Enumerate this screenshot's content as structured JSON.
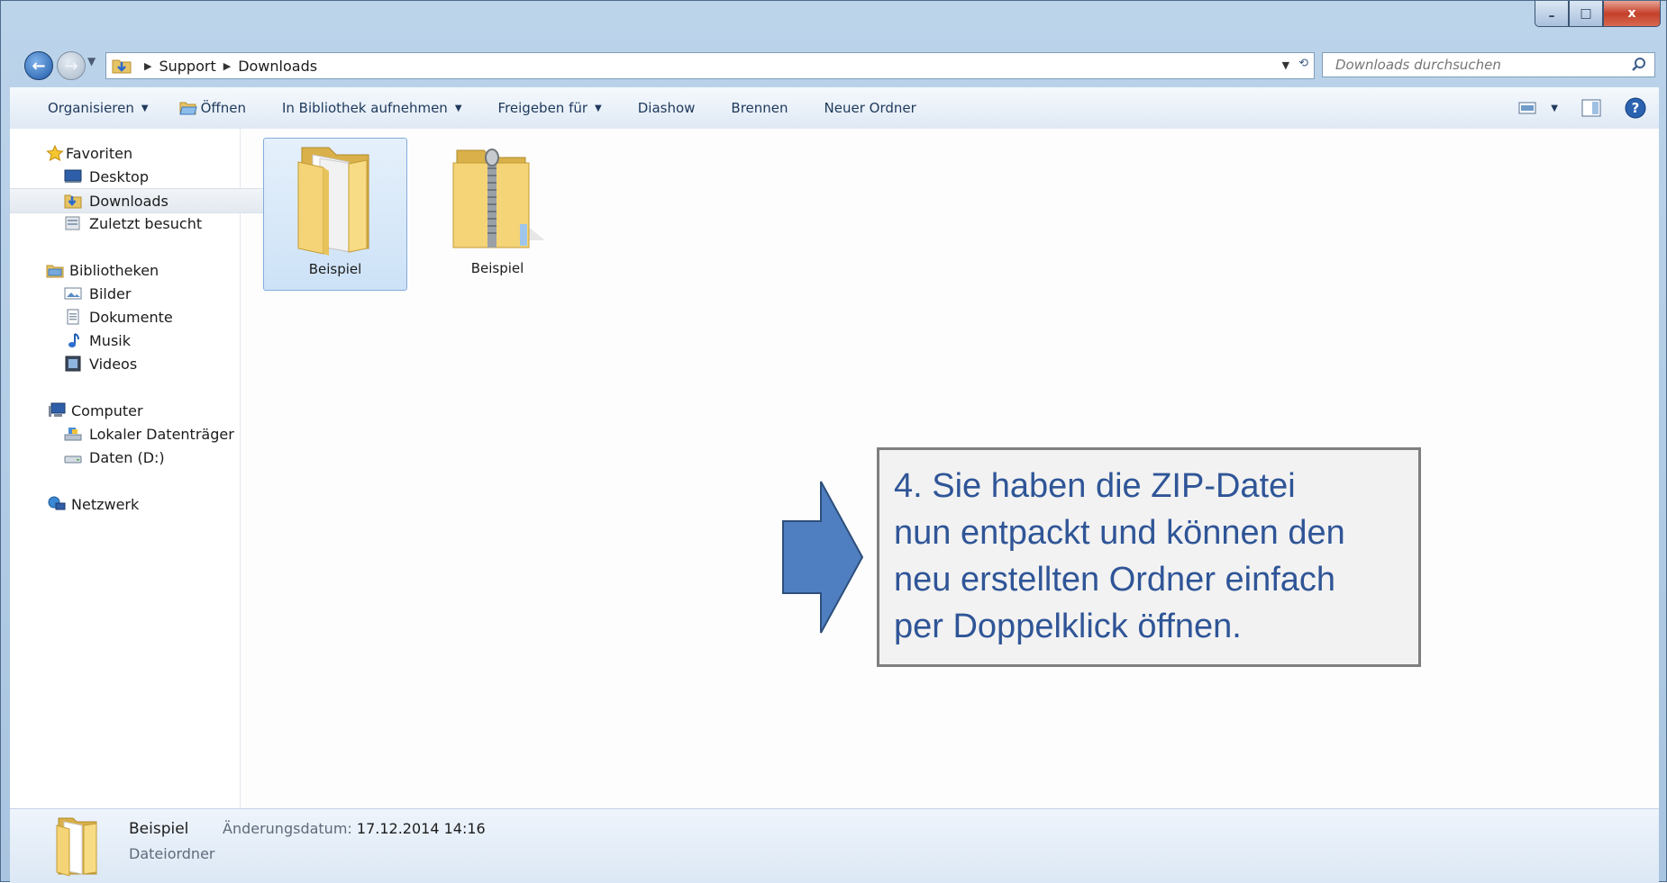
{
  "window": {
    "minimize": "–",
    "maximize": "□",
    "close": "x"
  },
  "address": {
    "crumbs": [
      "Support",
      "Downloads"
    ],
    "search_placeholder": "Downloads durchsuchen"
  },
  "toolbar": {
    "organize": "Organisieren",
    "open": "Öffnen",
    "include_library": "In Bibliothek aufnehmen",
    "share": "Freigeben für",
    "slideshow": "Diashow",
    "burn": "Brennen",
    "new_folder": "Neuer Ordner"
  },
  "nav": {
    "favorites": "Favoriten",
    "favorites_items": [
      "Desktop",
      "Downloads",
      "Zuletzt besucht"
    ],
    "libraries": "Bibliotheken",
    "libraries_items": [
      "Bilder",
      "Dokumente",
      "Musik",
      "Videos"
    ],
    "computer": "Computer",
    "computer_items": [
      "Lokaler Datenträger",
      "Daten (D:)"
    ],
    "network": "Netzwerk"
  },
  "files": [
    {
      "name": "Beispiel",
      "type": "folder"
    },
    {
      "name": "Beispiel",
      "type": "zip"
    }
  ],
  "callout": {
    "lines": [
      "4. Sie haben die ZIP-Datei",
      "nun entpackt und können den",
      "neu erstellten Ordner einfach",
      "per Doppelklick öffnen."
    ]
  },
  "details": {
    "name": "Beispiel",
    "date_label": "Änderungsdatum:",
    "date": "17.12.2014 14:16",
    "type": "Dateiordner"
  },
  "colors": {
    "callout_text": "#2f5597",
    "arrow_fill": "#4f7fc0",
    "selection": "#cde2f7"
  }
}
